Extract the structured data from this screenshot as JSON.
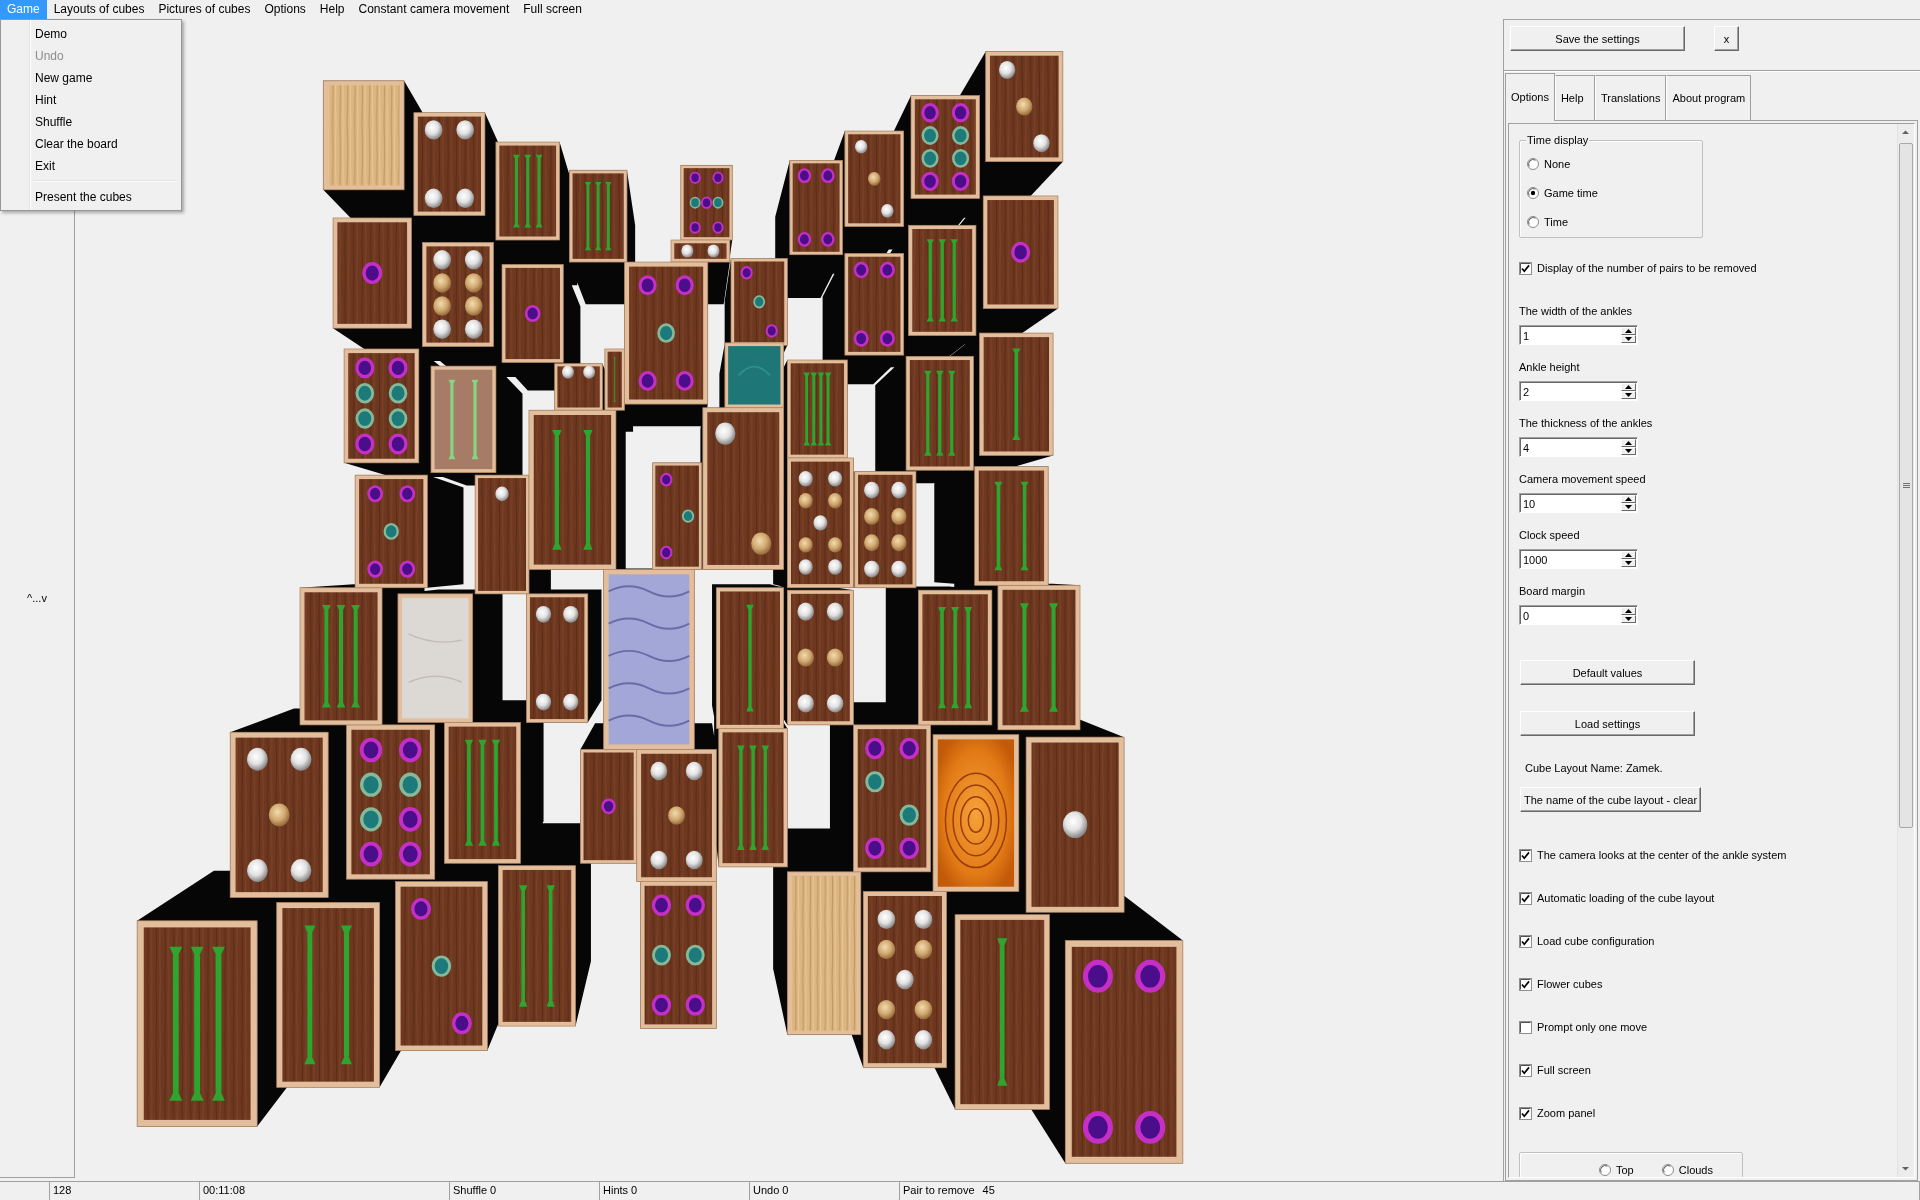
{
  "menu_bar": {
    "items": [
      {
        "label": "Game",
        "selected": true
      },
      {
        "label": "Layouts of cubes",
        "selected": false
      },
      {
        "label": "Pictures of cubes",
        "selected": false
      },
      {
        "label": "Options",
        "selected": false
      },
      {
        "label": "Help",
        "selected": false
      },
      {
        "label": "Constant camera movement",
        "selected": false
      },
      {
        "label": "Full screen",
        "selected": false
      }
    ]
  },
  "game_menu": {
    "items": [
      {
        "kind": "item",
        "label": "Demo",
        "disabled": false
      },
      {
        "kind": "item",
        "label": "Undo",
        "disabled": true
      },
      {
        "kind": "item",
        "label": "New game",
        "disabled": false
      },
      {
        "kind": "item",
        "label": "Hint",
        "disabled": false
      },
      {
        "kind": "item",
        "label": "Shuffle",
        "disabled": false
      },
      {
        "kind": "item",
        "label": "Clear the board",
        "disabled": false
      },
      {
        "kind": "item",
        "label": "Exit",
        "disabled": false
      },
      {
        "kind": "separator"
      },
      {
        "kind": "item",
        "label": "Present the cubes",
        "disabled": false
      }
    ]
  },
  "side_panel": {
    "toggle": "^...v"
  },
  "settings_panel": {
    "save_button": "Save the settings",
    "close_button": "x",
    "tabs": [
      {
        "label": "Options",
        "selected": true
      },
      {
        "label": "Help",
        "selected": false
      },
      {
        "label": "Translations",
        "selected": false
      },
      {
        "label": "About program",
        "selected": false
      }
    ],
    "controls": [
      {
        "kind": "radio_group",
        "title": "Time display",
        "options": [
          {
            "label": "None",
            "selected": false
          },
          {
            "label": "Game time",
            "selected": true
          },
          {
            "label": "Time",
            "selected": false
          }
        ]
      },
      {
        "kind": "checkbox",
        "label": "Display of the number of pairs to be removed",
        "checked": true
      },
      {
        "kind": "spin",
        "label": "The width of the ankles",
        "value": "1"
      },
      {
        "kind": "spin",
        "label": "Ankle height",
        "value": "2"
      },
      {
        "kind": "spin",
        "label": "The thickness of the ankles",
        "value": "4"
      },
      {
        "kind": "spin",
        "label": "Camera movement speed",
        "value": "10"
      },
      {
        "kind": "spin",
        "label": "Clock speed",
        "value": "1000"
      },
      {
        "kind": "spin",
        "label": "Board margin",
        "value": "0"
      },
      {
        "kind": "button",
        "label": "Default values"
      },
      {
        "kind": "button",
        "label": "Load settings"
      },
      {
        "kind": "text",
        "label": "Cube Layout Name: Zamek."
      },
      {
        "kind": "button",
        "label": "The name of the cube layout - clear"
      },
      {
        "kind": "checkbox",
        "label": "The camera looks at the center of the ankle system",
        "checked": true
      },
      {
        "kind": "checkbox",
        "label": "Automatic loading of the cube layout",
        "checked": true
      },
      {
        "kind": "checkbox",
        "label": "Load cube configuration",
        "checked": true
      },
      {
        "kind": "checkbox",
        "label": "Flower cubes",
        "checked": true
      },
      {
        "kind": "checkbox",
        "label": "Prompt only one move",
        "checked": false
      },
      {
        "kind": "checkbox",
        "label": "Full screen",
        "checked": true
      },
      {
        "kind": "checkbox",
        "label": "Zoom panel",
        "checked": true
      },
      {
        "kind": "radio_row",
        "options": [
          {
            "label": "Top",
            "selected": false
          },
          {
            "label": "Clouds",
            "selected": false
          }
        ]
      }
    ]
  },
  "status_bar": {
    "panels": [
      "128",
      "00:11:08",
      "Shuffle 0",
      "Hints 0",
      "Undo 0"
    ],
    "pair_to_remove": {
      "label": "Pair to remove",
      "value": "45"
    }
  }
}
